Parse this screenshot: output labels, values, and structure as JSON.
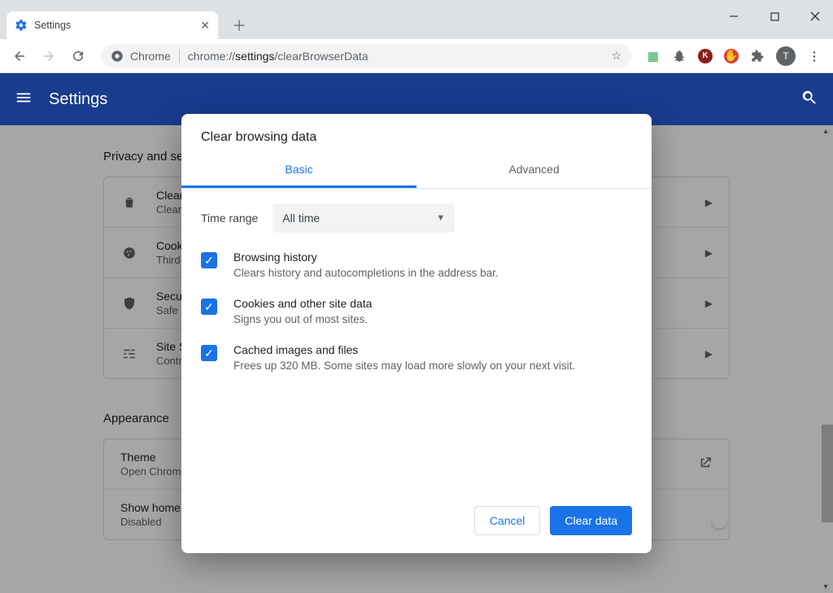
{
  "window": {
    "tab_title": "Settings",
    "avatar_letter": "T"
  },
  "omnibox": {
    "chip": "Chrome",
    "url_prefix": "chrome://",
    "url_dark": "settings",
    "url_suffix": "/clearBrowserData"
  },
  "app": {
    "header_title": "Settings",
    "sections": {
      "privacy_title": "Privacy and security",
      "appearance_title": "Appearance"
    },
    "rows": {
      "clear": {
        "title": "Clear browsing data",
        "sub": "Clear history, cookies, cache, and more"
      },
      "cookies": {
        "title": "Cookies and other site data",
        "sub": "Third-party cookies are blocked in Incognito mode"
      },
      "security": {
        "title": "Security",
        "sub": "Safe Browsing (protection from dangerous sites) and other security settings"
      },
      "site": {
        "title": "Site Settings",
        "sub": "Controls what information sites can use and show"
      },
      "theme": {
        "title": "Theme",
        "sub": "Open Chrome Web Store"
      },
      "home": {
        "title": "Show home button",
        "sub": "Disabled"
      }
    }
  },
  "dialog": {
    "title": "Clear browsing data",
    "tabs": {
      "basic": "Basic",
      "advanced": "Advanced"
    },
    "time_label": "Time range",
    "time_value": "All time",
    "items": [
      {
        "title": "Browsing history",
        "sub": "Clears history and autocompletions in the address bar."
      },
      {
        "title": "Cookies and other site data",
        "sub": "Signs you out of most sites."
      },
      {
        "title": "Cached images and files",
        "sub": "Frees up 320 MB. Some sites may load more slowly on your next visit."
      }
    ],
    "cancel": "Cancel",
    "confirm": "Clear data"
  }
}
